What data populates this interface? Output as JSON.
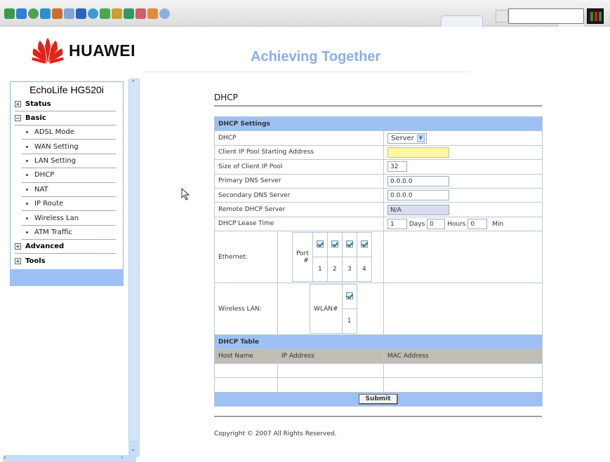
{
  "header": {
    "brand": "HUAWEI",
    "tagline": "Achieving Together",
    "brand_color": "#e2231a",
    "accent_color": "#9cc1f2"
  },
  "sidebar": {
    "title": "EchoLife HG520i",
    "sections": [
      {
        "label": "Status",
        "expanded": false
      },
      {
        "label": "Basic",
        "expanded": true,
        "items": [
          "ADSL Mode",
          "WAN Setting",
          "LAN Setting",
          "DHCP",
          "NAT",
          "IP Route",
          "Wireless Lan",
          "ATM Traffic"
        ]
      },
      {
        "label": "Advanced",
        "expanded": false
      },
      {
        "label": "Tools",
        "expanded": false
      }
    ]
  },
  "main": {
    "title": "DHCP",
    "settings": {
      "header": "DHCP Settings",
      "dhcp_label": "DHCP",
      "dhcp_value": "Server",
      "pool_start_label": "Client IP Pool Starting Address",
      "pool_start_value": "",
      "pool_size_label": "Size of Client IP Pool",
      "pool_size_value": "32",
      "primary_dns_label": "Primary DNS Server",
      "primary_dns_value": "0.0.0.0",
      "secondary_dns_label": "Secondary DNS Server",
      "secondary_dns_value": "0.0.0.0",
      "remote_dhcp_label": "Remote DHCP Server",
      "remote_dhcp_value": "N/A",
      "lease_label": "DHCP Lease Time",
      "lease_days": "1",
      "days_unit": "Days",
      "lease_hours": "0",
      "hours_unit": "Hours",
      "lease_min": "0",
      "min_unit": "Min",
      "ethernet_label": "Ethernet:",
      "port_label": "Port #",
      "ports": [
        "1",
        "2",
        "3",
        "4"
      ],
      "wireless_label": "Wireless LAN:",
      "wlan_label": "WLAN#",
      "wlans": [
        "1"
      ]
    },
    "table": {
      "header": "DHCP Table",
      "columns": [
        "Host Name",
        "IP Address",
        "MAC Address"
      ],
      "rows": [
        [
          "",
          "",
          ""
        ],
        [
          "",
          "",
          ""
        ]
      ]
    },
    "submit_label": "Submit",
    "copyright": "Copyright © 2007 All Rights Reserved."
  }
}
